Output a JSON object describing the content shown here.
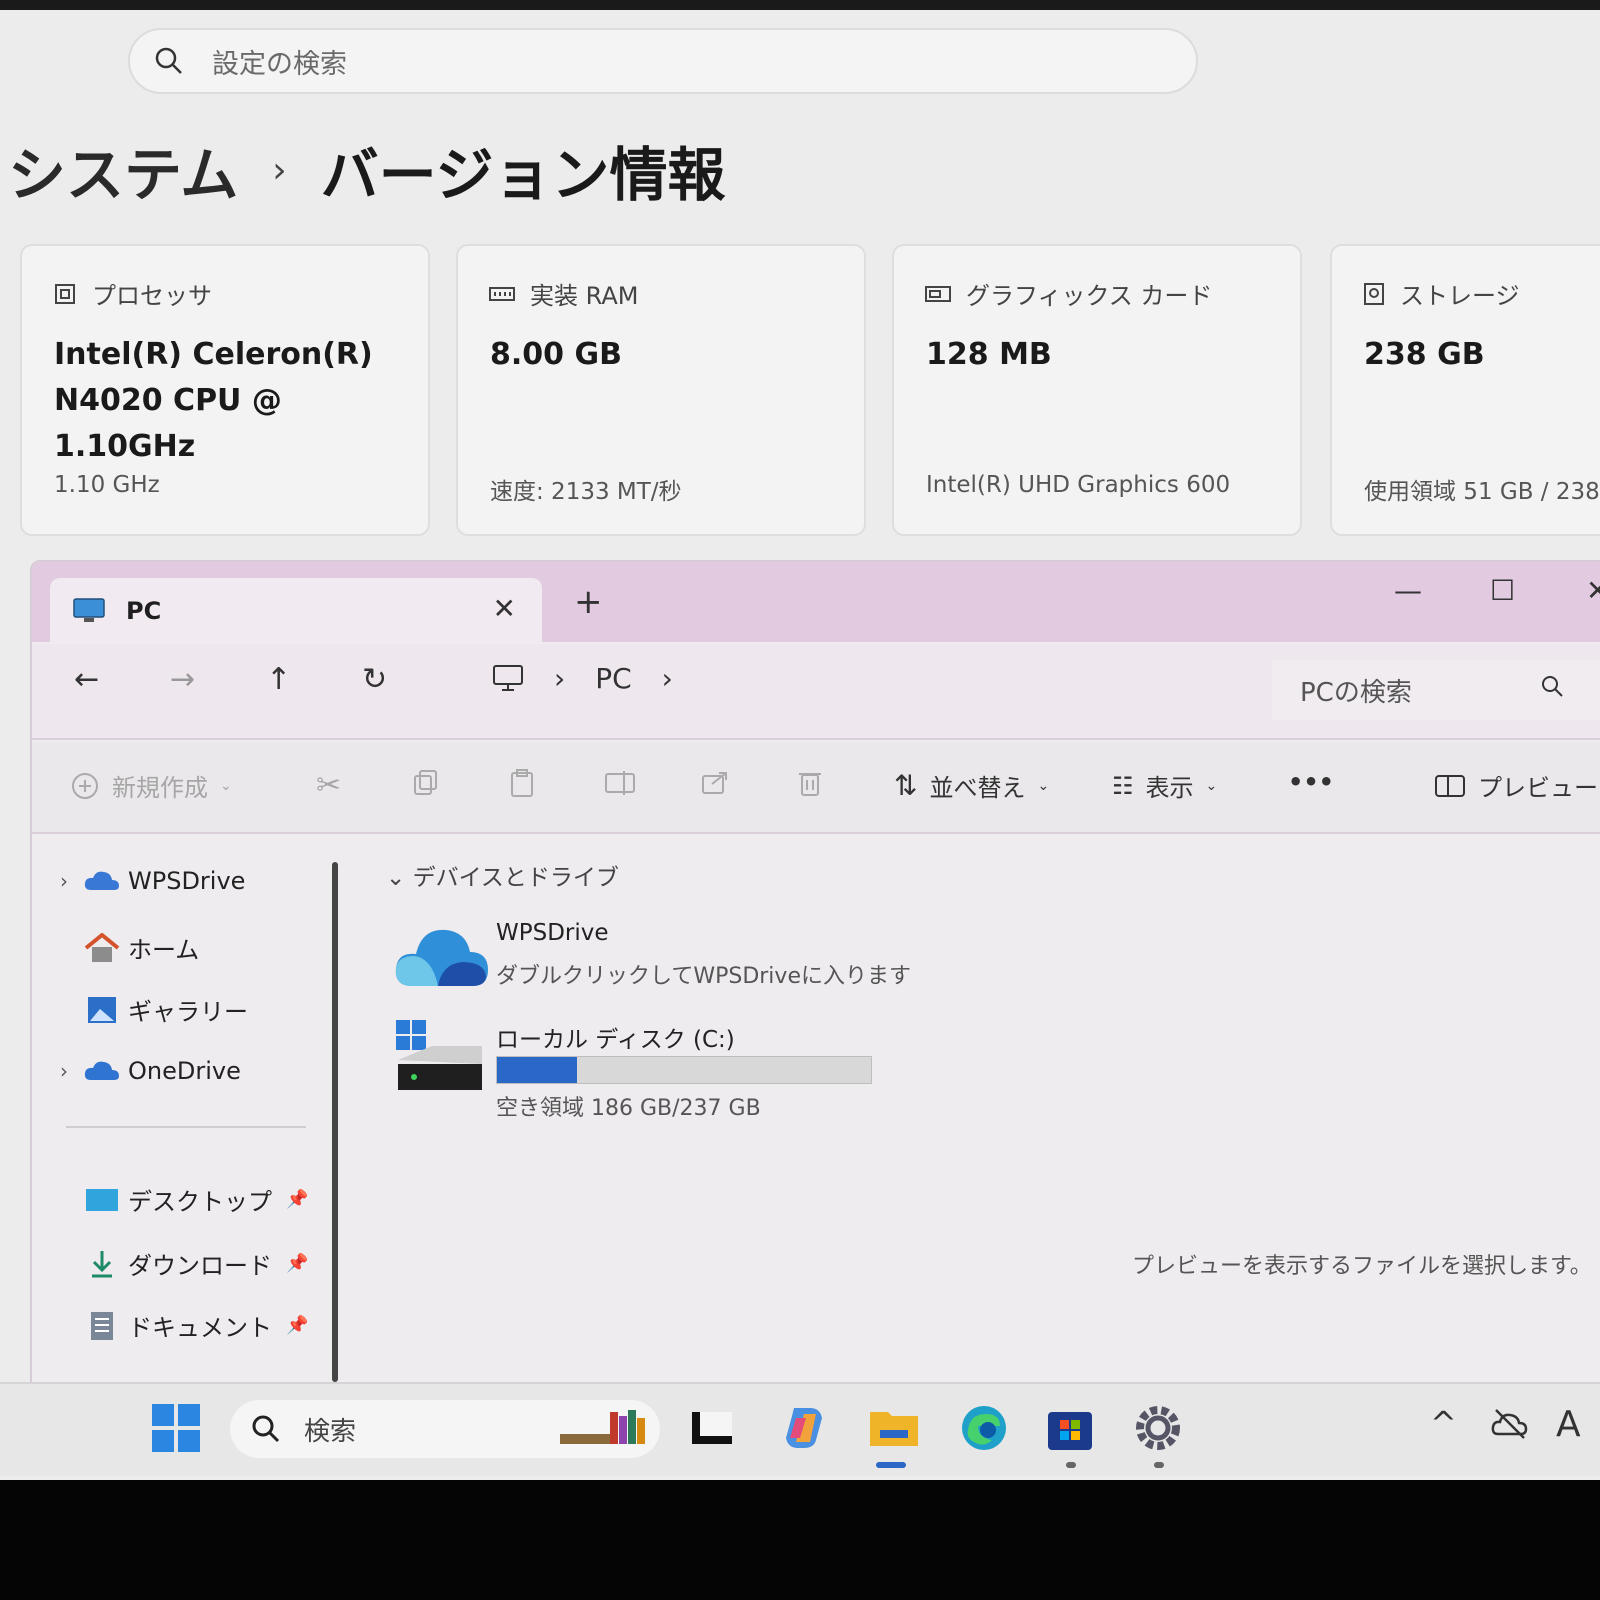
{
  "settings": {
    "search_placeholder": "設定の検索",
    "breadcrumb": [
      "システム",
      "バージョン情報"
    ],
    "cards": [
      {
        "label": "プロセッサ",
        "value": "Intel(R) Celeron(R) N4020 CPU @ 1.10GHz",
        "sub": "1.10 GHz",
        "icon": "processor-icon"
      },
      {
        "label": "実装 RAM",
        "value": "8.00 GB",
        "sub": "速度: 2133 MT/秒",
        "icon": "ram-icon"
      },
      {
        "label": "グラフィックス カード",
        "value": "128 MB",
        "sub": "Intel(R) UHD Graphics 600",
        "icon": "graphics-card-icon"
      },
      {
        "label": "ストレージ",
        "value": "238 GB",
        "sub": "使用領域 51 GB / 238",
        "icon": "storage-icon"
      }
    ]
  },
  "explorer": {
    "tab_title": "PC",
    "address": [
      "PC"
    ],
    "search_placeholder": "PCの検索",
    "commands": {
      "new": "新規作成",
      "sort": "並べ替え",
      "view": "表示",
      "more": "•••",
      "preview": "プレビュー"
    },
    "nav": [
      {
        "label": "WPSDrive",
        "expandable": true
      },
      {
        "label": "ホーム",
        "expandable": false
      },
      {
        "label": "ギャラリー",
        "expandable": false
      },
      {
        "label": "OneDrive",
        "expandable": true
      },
      {
        "label": "デスクトップ",
        "pinned": true
      },
      {
        "label": "ダウンロード",
        "pinned": true
      },
      {
        "label": "ドキュメント",
        "pinned": true
      }
    ],
    "group_label": "デバイスとドライブ",
    "drives": [
      {
        "name": "WPSDrive",
        "sub": "ダブルクリックしてWPSDriveに入ります"
      },
      {
        "name": "ローカル ディスク (C:)",
        "sub": "空き領域 186 GB/237 GB",
        "used_fraction": 0.215
      }
    ],
    "preview_message": "プレビューを表示するファイルを選択します。"
  },
  "taskbar": {
    "search_placeholder": "検索",
    "tray_letter": "A"
  },
  "colors": {
    "accent": "#2a67c7",
    "tab_strip": "#e2cbe0"
  }
}
